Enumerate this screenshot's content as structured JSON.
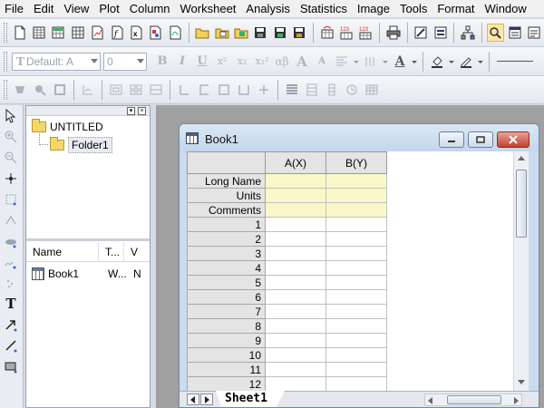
{
  "menu": [
    "File",
    "Edit",
    "View",
    "Plot",
    "Column",
    "Worksheet",
    "Analysis",
    "Statistics",
    "Image",
    "Tools",
    "Format",
    "Window"
  ],
  "format_toolbar": {
    "font_value": "Default: A",
    "size_value": "0",
    "bold": "B",
    "italic": "I",
    "underline": "U",
    "superscript": "x²",
    "subscript": "x₂",
    "supersub": "x₁²",
    "greek": "αβ",
    "grow_font": "A",
    "shrink_font": "A",
    "font_color": "A"
  },
  "explorer": {
    "root_folder": "UNTITLED",
    "subfolder": "Folder1",
    "list_columns": [
      "Name",
      "T...",
      "V"
    ],
    "list_items": [
      {
        "name": "Book1",
        "type": "W...",
        "view": "N"
      }
    ]
  },
  "book": {
    "title": "Book1",
    "columns": [
      "A(X)",
      "B(Y)"
    ],
    "meta_rows": [
      "Long Name",
      "Units",
      "Comments"
    ],
    "rows": [
      "1",
      "2",
      "3",
      "4",
      "5",
      "6",
      "7",
      "8",
      "9",
      "10",
      "11",
      "12"
    ],
    "sheet_tab": "Sheet1"
  },
  "colors": {
    "meta_row_bg": "#faf8c9",
    "header_bg": "#e4e4e4",
    "window_frame": "#c9dcef",
    "close_button": "#c5402d"
  }
}
